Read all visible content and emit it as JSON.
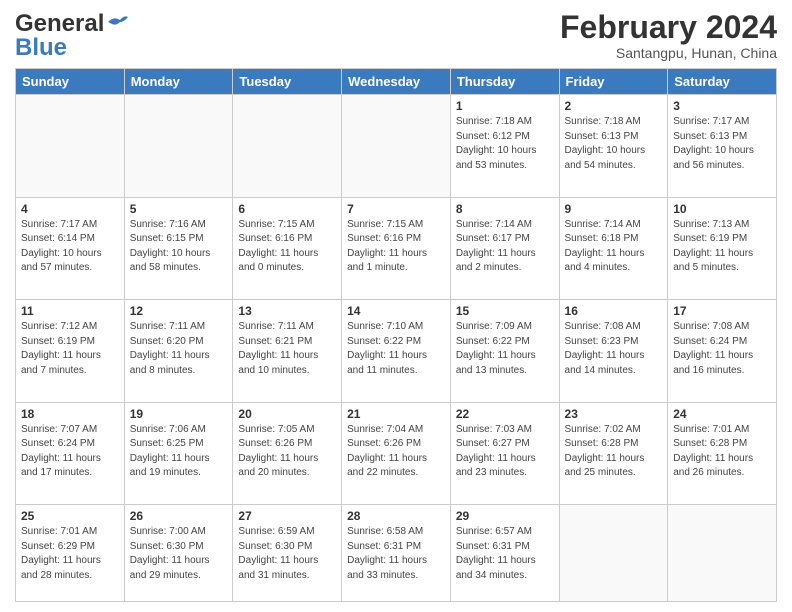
{
  "header": {
    "logo_general": "General",
    "logo_blue": "Blue",
    "month_year": "February 2024",
    "location": "Santangpu, Hunan, China"
  },
  "days_of_week": [
    "Sunday",
    "Monday",
    "Tuesday",
    "Wednesday",
    "Thursday",
    "Friday",
    "Saturday"
  ],
  "weeks": [
    [
      {
        "day": null,
        "info": null
      },
      {
        "day": null,
        "info": null
      },
      {
        "day": null,
        "info": null
      },
      {
        "day": null,
        "info": null
      },
      {
        "day": "1",
        "info": "Sunrise: 7:18 AM\nSunset: 6:12 PM\nDaylight: 10 hours\nand 53 minutes."
      },
      {
        "day": "2",
        "info": "Sunrise: 7:18 AM\nSunset: 6:13 PM\nDaylight: 10 hours\nand 54 minutes."
      },
      {
        "day": "3",
        "info": "Sunrise: 7:17 AM\nSunset: 6:13 PM\nDaylight: 10 hours\nand 56 minutes."
      }
    ],
    [
      {
        "day": "4",
        "info": "Sunrise: 7:17 AM\nSunset: 6:14 PM\nDaylight: 10 hours\nand 57 minutes."
      },
      {
        "day": "5",
        "info": "Sunrise: 7:16 AM\nSunset: 6:15 PM\nDaylight: 10 hours\nand 58 minutes."
      },
      {
        "day": "6",
        "info": "Sunrise: 7:15 AM\nSunset: 6:16 PM\nDaylight: 11 hours\nand 0 minutes."
      },
      {
        "day": "7",
        "info": "Sunrise: 7:15 AM\nSunset: 6:16 PM\nDaylight: 11 hours\nand 1 minute."
      },
      {
        "day": "8",
        "info": "Sunrise: 7:14 AM\nSunset: 6:17 PM\nDaylight: 11 hours\nand 2 minutes."
      },
      {
        "day": "9",
        "info": "Sunrise: 7:14 AM\nSunset: 6:18 PM\nDaylight: 11 hours\nand 4 minutes."
      },
      {
        "day": "10",
        "info": "Sunrise: 7:13 AM\nSunset: 6:19 PM\nDaylight: 11 hours\nand 5 minutes."
      }
    ],
    [
      {
        "day": "11",
        "info": "Sunrise: 7:12 AM\nSunset: 6:19 PM\nDaylight: 11 hours\nand 7 minutes."
      },
      {
        "day": "12",
        "info": "Sunrise: 7:11 AM\nSunset: 6:20 PM\nDaylight: 11 hours\nand 8 minutes."
      },
      {
        "day": "13",
        "info": "Sunrise: 7:11 AM\nSunset: 6:21 PM\nDaylight: 11 hours\nand 10 minutes."
      },
      {
        "day": "14",
        "info": "Sunrise: 7:10 AM\nSunset: 6:22 PM\nDaylight: 11 hours\nand 11 minutes."
      },
      {
        "day": "15",
        "info": "Sunrise: 7:09 AM\nSunset: 6:22 PM\nDaylight: 11 hours\nand 13 minutes."
      },
      {
        "day": "16",
        "info": "Sunrise: 7:08 AM\nSunset: 6:23 PM\nDaylight: 11 hours\nand 14 minutes."
      },
      {
        "day": "17",
        "info": "Sunrise: 7:08 AM\nSunset: 6:24 PM\nDaylight: 11 hours\nand 16 minutes."
      }
    ],
    [
      {
        "day": "18",
        "info": "Sunrise: 7:07 AM\nSunset: 6:24 PM\nDaylight: 11 hours\nand 17 minutes."
      },
      {
        "day": "19",
        "info": "Sunrise: 7:06 AM\nSunset: 6:25 PM\nDaylight: 11 hours\nand 19 minutes."
      },
      {
        "day": "20",
        "info": "Sunrise: 7:05 AM\nSunset: 6:26 PM\nDaylight: 11 hours\nand 20 minutes."
      },
      {
        "day": "21",
        "info": "Sunrise: 7:04 AM\nSunset: 6:26 PM\nDaylight: 11 hours\nand 22 minutes."
      },
      {
        "day": "22",
        "info": "Sunrise: 7:03 AM\nSunset: 6:27 PM\nDaylight: 11 hours\nand 23 minutes."
      },
      {
        "day": "23",
        "info": "Sunrise: 7:02 AM\nSunset: 6:28 PM\nDaylight: 11 hours\nand 25 minutes."
      },
      {
        "day": "24",
        "info": "Sunrise: 7:01 AM\nSunset: 6:28 PM\nDaylight: 11 hours\nand 26 minutes."
      }
    ],
    [
      {
        "day": "25",
        "info": "Sunrise: 7:01 AM\nSunset: 6:29 PM\nDaylight: 11 hours\nand 28 minutes."
      },
      {
        "day": "26",
        "info": "Sunrise: 7:00 AM\nSunset: 6:30 PM\nDaylight: 11 hours\nand 29 minutes."
      },
      {
        "day": "27",
        "info": "Sunrise: 6:59 AM\nSunset: 6:30 PM\nDaylight: 11 hours\nand 31 minutes."
      },
      {
        "day": "28",
        "info": "Sunrise: 6:58 AM\nSunset: 6:31 PM\nDaylight: 11 hours\nand 33 minutes."
      },
      {
        "day": "29",
        "info": "Sunrise: 6:57 AM\nSunset: 6:31 PM\nDaylight: 11 hours\nand 34 minutes."
      },
      {
        "day": null,
        "info": null
      },
      {
        "day": null,
        "info": null
      }
    ]
  ]
}
